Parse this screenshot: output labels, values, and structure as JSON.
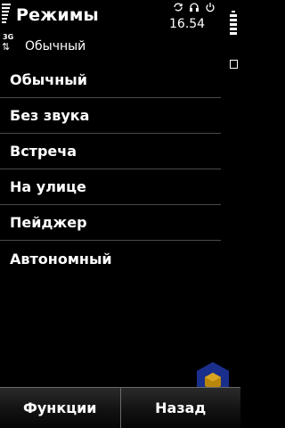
{
  "header": {
    "title": "Режимы",
    "subtitle": "Обычный",
    "network": "3G",
    "time": "16.54",
    "icons": [
      "sync-icon",
      "headset-icon",
      "power-icon"
    ]
  },
  "list": {
    "items": [
      {
        "label": "Обычный"
      },
      {
        "label": "Без звука"
      },
      {
        "label": "Встреча"
      },
      {
        "label": "На улице"
      },
      {
        "label": "Пейджер"
      },
      {
        "label": "Автономный"
      }
    ]
  },
  "softkeys": {
    "left_label": "Функции",
    "right_label": "Назад"
  },
  "colors": {
    "background": "#000000",
    "text": "#ffffff",
    "divider": "#4a4a4a",
    "watermark_blue": "#1a2e8c",
    "watermark_gold": "#b8860b"
  }
}
